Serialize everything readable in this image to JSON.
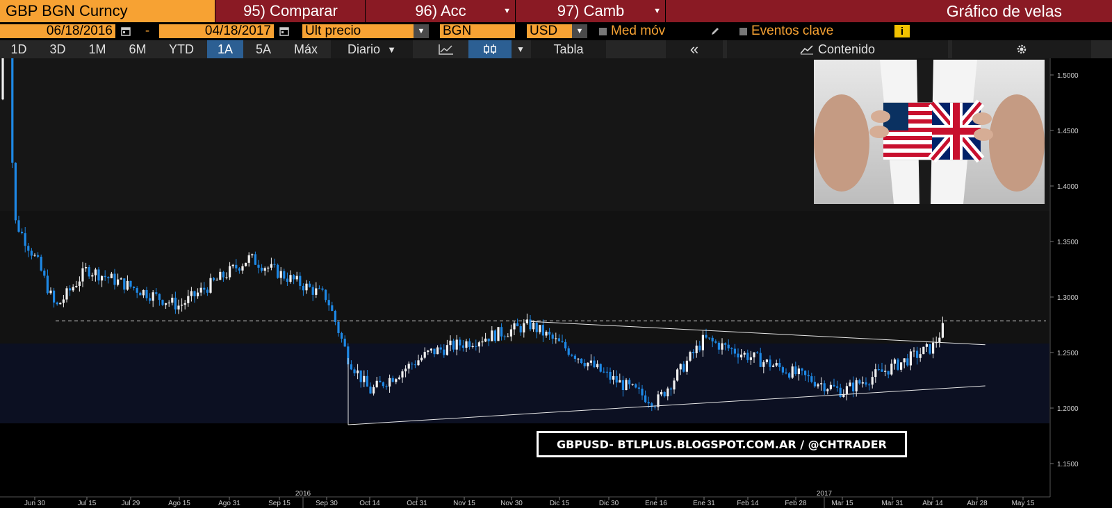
{
  "header": {
    "ticker": "GBP BGN Curncy",
    "compare": "95) Comparar",
    "actions": "96) Acc",
    "exchange": "97) Camb",
    "title": "Gráfico de velas"
  },
  "params": {
    "start_date": "06/18/2016",
    "dash": "-",
    "end_date": "04/18/2017",
    "field": "Últ precio",
    "source": "BGN",
    "currency": "USD",
    "moving_avg": "Med móv",
    "key_events": "Eventos clave",
    "info": "i"
  },
  "toolbar": {
    "periods": [
      "1D",
      "3D",
      "1M",
      "6M",
      "YTD",
      "1A",
      "5A",
      "Máx"
    ],
    "active_period": "1A",
    "frequency": "Diario",
    "table": "Tabla",
    "collapse": "«",
    "contents": "Contenido"
  },
  "colors": {
    "header_red": "#8a1a24",
    "field_orange": "#f7a233",
    "candle_up": "#f0f0f0",
    "candle_down": "#1e88e5",
    "active_tab": "#2c5f93"
  },
  "watermark": "GBPUSD- BTLPLUS.BLOGSPOT.COM.AR / @CHTRADER",
  "icons": {
    "calendar": "calendar-icon",
    "pencil": "pencil-icon",
    "line_chart": "line-chart-icon",
    "candles": "candlestick-icon",
    "settings": "gear-icon"
  },
  "chart_data": {
    "type": "candlestick",
    "y_ticks": [
      "1.5000",
      "1.4500",
      "1.4000",
      "1.3500",
      "1.3000",
      "1.2500",
      "1.2000",
      "1.1500"
    ],
    "ylim": [
      1.13,
      1.505
    ],
    "x_ticks": [
      "Jun 30",
      "Jul 15",
      "Jul 29",
      "Ago 15",
      "Ago 31",
      "Sep 15",
      "Sep 30",
      "Oct 14",
      "Oct 31",
      "Nov 15",
      "Nov 30",
      "Dic 15",
      "Dic 30",
      "Ene 16",
      "Ene 31",
      "Feb 14",
      "Feb 28",
      "Mar 15",
      "Mar 31",
      "Abr 14",
      "Abr 28",
      "May 15"
    ],
    "x_years": [
      "2016",
      "2017"
    ],
    "key_closes": [
      {
        "x": "Jun 23",
        "y": 1.488
      },
      {
        "x": "Jun 24",
        "y": 1.37
      },
      {
        "x": "Jul 1",
        "y": 1.33
      },
      {
        "x": "Jul 6",
        "y": 1.29
      },
      {
        "x": "Jul 15",
        "y": 1.325
      },
      {
        "x": "Ago 15",
        "y": 1.292
      },
      {
        "x": "Sep 6",
        "y": 1.335
      },
      {
        "x": "Sep 30",
        "y": 1.3
      },
      {
        "x": "Oct 7",
        "y": 1.245
      },
      {
        "x": "Oct 14",
        "y": 1.215
      },
      {
        "x": "Nov 4",
        "y": 1.25
      },
      {
        "x": "Dic 6",
        "y": 1.275
      },
      {
        "x": "Dic 30",
        "y": 1.228
      },
      {
        "x": "Ene 16",
        "y": 1.205
      },
      {
        "x": "Ene 31",
        "y": 1.262
      },
      {
        "x": "Mar 15",
        "y": 1.215
      },
      {
        "x": "Abr 14",
        "y": 1.255
      },
      {
        "x": "Abr 18",
        "y": 1.276
      }
    ],
    "horizontal_line": 1.2785,
    "trendlines": [
      {
        "from": {
          "x": "Dic 6",
          "y": 1.278
        },
        "to": {
          "x": "May 1",
          "y": 1.257
        }
      },
      {
        "from": {
          "x": "Oct 7",
          "y": 1.185
        },
        "to": {
          "x": "May 1",
          "y": 1.22
        }
      }
    ],
    "grid": false
  }
}
